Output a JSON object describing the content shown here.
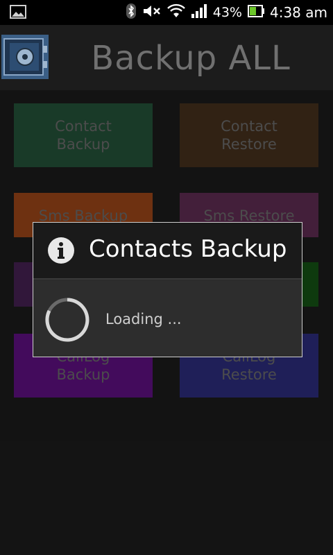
{
  "status_bar": {
    "battery_percent": "43%",
    "time": "4:38 am",
    "icons": [
      "image-icon",
      "bluetooth-icon",
      "mute-icon",
      "wifi-icon",
      "signal-icon",
      "battery-icon"
    ]
  },
  "app": {
    "title": "Backup ALL"
  },
  "tiles": [
    {
      "label": "Contact\nBackup",
      "color": "#2f6a4a"
    },
    {
      "label": "Contact\nRestore",
      "color": "#5a3e25"
    },
    {
      "label": "Sms Backup",
      "color": "#c85a20"
    },
    {
      "label": "Sms Restore",
      "color": "#7a3a6a"
    },
    {
      "label": "",
      "color": "#5a2a6a"
    },
    {
      "label": "",
      "color": "#1a6a1a"
    },
    {
      "label": "CallLog\nBackup",
      "color": "#7a14a8"
    },
    {
      "label": "CallLog\nRestore",
      "color": "#3a3aa0"
    }
  ],
  "dialog": {
    "title": "Contacts Backup",
    "message": "Loading ..."
  }
}
